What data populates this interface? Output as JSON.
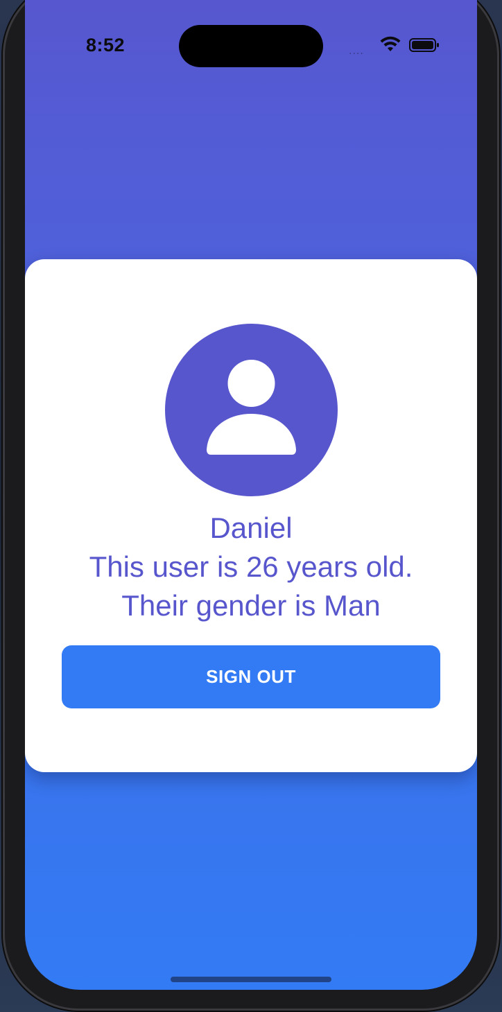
{
  "status_bar": {
    "time": "8:52",
    "signal": "....",
    "icons": [
      "wifi-icon",
      "battery-icon"
    ]
  },
  "profile": {
    "avatar_icon": "person-icon",
    "name": "Daniel",
    "age_text": "This user is 26 years old.",
    "gender_text": "Their gender is Man"
  },
  "actions": {
    "sign_out_label": "SIGN OUT"
  },
  "colors": {
    "gradient_top": "#5757cf",
    "gradient_bottom": "#337bf4",
    "accent_purple": "#5856cd",
    "button_blue": "#337bf4",
    "card_bg": "#ffffff"
  }
}
